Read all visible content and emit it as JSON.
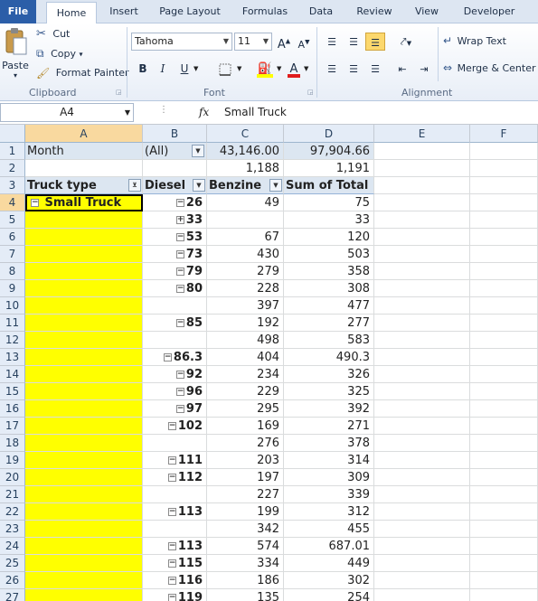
{
  "tabs": [
    "File",
    "Home",
    "Insert",
    "Page Layout",
    "Formulas",
    "Data",
    "Review",
    "View",
    "Developer"
  ],
  "clipboard": {
    "group_label": "Clipboard",
    "paste": "Paste",
    "cut": "Cut",
    "copy": "Copy",
    "format_painter": "Format Painter"
  },
  "font": {
    "group_label": "Font",
    "family": "Tahoma",
    "size": "11",
    "bold": "B",
    "italic": "I",
    "underline": "U"
  },
  "alignment": {
    "group_label": "Alignment",
    "wrap_text": "Wrap Text",
    "merge_center": "Merge & Center"
  },
  "formula_bar": {
    "name_box": "A4",
    "fx": "fx",
    "value": "Small Truck"
  },
  "columns": [
    "A",
    "B",
    "C",
    "D",
    "E",
    "F"
  ],
  "rows": [
    {
      "num": "1",
      "a": "Month",
      "b": "(All)",
      "c": "43,146.00",
      "d": "97,904.66"
    },
    {
      "num": "2",
      "a": "",
      "b": "",
      "c": "1,188",
      "d": "1,191"
    },
    {
      "num": "3",
      "a": "Truck type",
      "b": "Diesel",
      "c": "Benzine",
      "d": "Sum of Total"
    },
    {
      "num": "4",
      "a": "Small Truck",
      "b": "26",
      "c": "49",
      "d": "75"
    },
    {
      "num": "5",
      "a": "",
      "b": "33",
      "c": "",
      "d": "33"
    },
    {
      "num": "6",
      "a": "",
      "b": "53",
      "c": "67",
      "d": "120"
    },
    {
      "num": "7",
      "a": "",
      "b": "73",
      "c": "430",
      "d": "503"
    },
    {
      "num": "8",
      "a": "",
      "b": "79",
      "c": "279",
      "d": "358"
    },
    {
      "num": "9",
      "a": "",
      "b": "80",
      "c": "228",
      "d": "308"
    },
    {
      "num": "10",
      "a": "",
      "b": "",
      "c": "397",
      "d": "477"
    },
    {
      "num": "11",
      "a": "",
      "b": "85",
      "c": "192",
      "d": "277"
    },
    {
      "num": "12",
      "a": "",
      "b": "",
      "c": "498",
      "d": "583"
    },
    {
      "num": "13",
      "a": "",
      "b": "86.3",
      "c": "404",
      "d": "490.3"
    },
    {
      "num": "14",
      "a": "",
      "b": "92",
      "c": "234",
      "d": "326"
    },
    {
      "num": "15",
      "a": "",
      "b": "96",
      "c": "229",
      "d": "325"
    },
    {
      "num": "16",
      "a": "",
      "b": "97",
      "c": "295",
      "d": "392"
    },
    {
      "num": "17",
      "a": "",
      "b": "102",
      "c": "169",
      "d": "271"
    },
    {
      "num": "18",
      "a": "",
      "b": "",
      "c": "276",
      "d": "378"
    },
    {
      "num": "19",
      "a": "",
      "b": "111",
      "c": "203",
      "d": "314"
    },
    {
      "num": "20",
      "a": "",
      "b": "112",
      "c": "197",
      "d": "309"
    },
    {
      "num": "21",
      "a": "",
      "b": "",
      "c": "227",
      "d": "339"
    },
    {
      "num": "22",
      "a": "",
      "b": "113",
      "c": "199",
      "d": "312"
    },
    {
      "num": "23",
      "a": "",
      "b": "",
      "c": "342",
      "d": "455"
    },
    {
      "num": "24",
      "a": "",
      "b": "113",
      "c": "574",
      "d": "687.01"
    },
    {
      "num": "25",
      "a": "",
      "b": "115",
      "c": "334",
      "d": "449"
    },
    {
      "num": "26",
      "a": "",
      "b": "116",
      "c": "186",
      "d": "302"
    },
    {
      "num": "27",
      "a": "",
      "b": "119",
      "c": "135",
      "d": "254"
    }
  ],
  "colors": {
    "highlight": "#ffff00",
    "pivot_header": "#dce6f1",
    "selection": "#000000"
  }
}
